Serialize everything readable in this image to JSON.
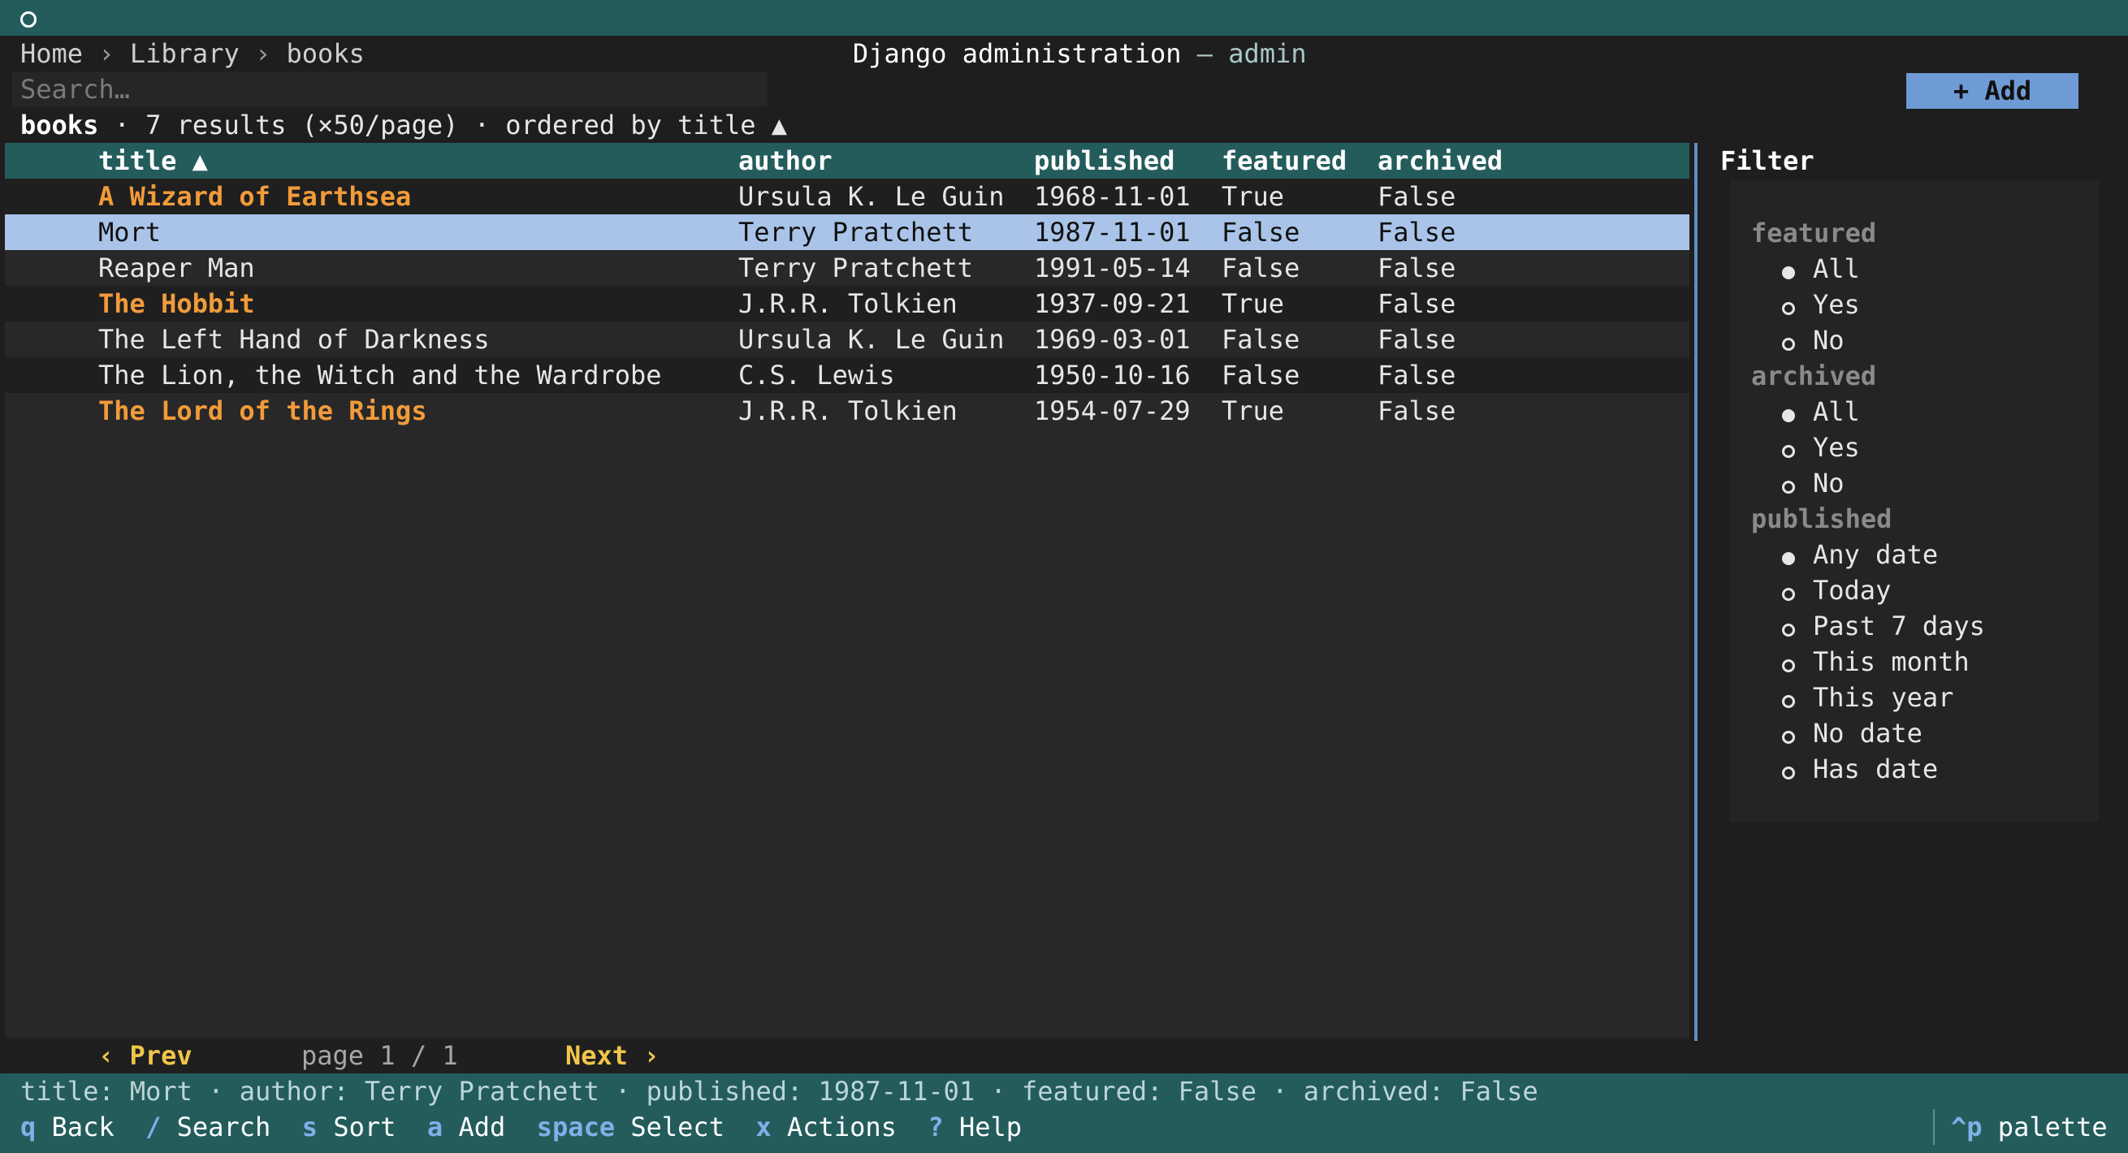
{
  "titlebar": {
    "title": "Django administration",
    "sep": " — ",
    "user": "admin"
  },
  "breadcrumb": {
    "home": "Home",
    "sep": " › ",
    "app": "Library",
    "model": "books"
  },
  "search": {
    "placeholder": "Search…"
  },
  "add_button": "+ Add",
  "summary": {
    "model": "books",
    "rest": " · 7 results (×50/page) · ordered by title ▲"
  },
  "table": {
    "columns": [
      "title ▲",
      "author",
      "published",
      "featured",
      "archived"
    ],
    "rows": [
      {
        "title": "A Wizard of Earthsea",
        "author": "Ursula K. Le Guin",
        "published": "1968-11-01",
        "featured": "True",
        "archived": "False"
      },
      {
        "title": "Mort",
        "author": "Terry Pratchett",
        "published": "1987-11-01",
        "featured": "False",
        "archived": "False"
      },
      {
        "title": "Reaper Man",
        "author": "Terry Pratchett",
        "published": "1991-05-14",
        "featured": "False",
        "archived": "False"
      },
      {
        "title": "The Hobbit",
        "author": "J.R.R. Tolkien",
        "published": "1937-09-21",
        "featured": "True",
        "archived": "False"
      },
      {
        "title": "The Left Hand of Darkness",
        "author": "Ursula K. Le Guin",
        "published": "1969-03-01",
        "featured": "False",
        "archived": "False"
      },
      {
        "title": "The Lion, the Witch and the Wardrobe",
        "author": "C.S. Lewis",
        "published": "1950-10-16",
        "featured": "False",
        "archived": "False"
      },
      {
        "title": "The Lord of the Rings",
        "author": "J.R.R. Tolkien",
        "published": "1954-07-29",
        "featured": "True",
        "archived": "False"
      }
    ]
  },
  "pager": {
    "prev": "‹ Prev",
    "page_label": "page",
    "page": "1 / 1",
    "next": "Next ›"
  },
  "filter": {
    "title": "Filter",
    "featured": {
      "label": "featured",
      "options": [
        "All",
        "Yes",
        "No"
      ]
    },
    "archived": {
      "label": "archived",
      "options": [
        "All",
        "Yes",
        "No"
      ]
    },
    "published": {
      "label": "published",
      "options": [
        "Any date",
        "Today",
        "Past 7 days",
        "This month",
        "This year",
        "No date",
        "Has date"
      ]
    }
  },
  "status": "title: Mort · author: Terry Pratchett · published: 1987-11-01 · featured: False · archived: False",
  "footer": {
    "keys": [
      {
        "key": "q",
        "label": "Back"
      },
      {
        "key": "/",
        "label": "Search"
      },
      {
        "key": "s",
        "label": "Sort"
      },
      {
        "key": "a",
        "label": "Add"
      },
      {
        "key": "space",
        "label": "Select"
      },
      {
        "key": "x",
        "label": "Actions"
      },
      {
        "key": "?",
        "label": "Help"
      }
    ],
    "palette": {
      "key": "^p",
      "label": "palette"
    }
  },
  "colors": {
    "accent": "#245c5c",
    "selection": "#a9c4e8",
    "featured_title": "#f29b3a",
    "button": "#6e9bd6"
  }
}
